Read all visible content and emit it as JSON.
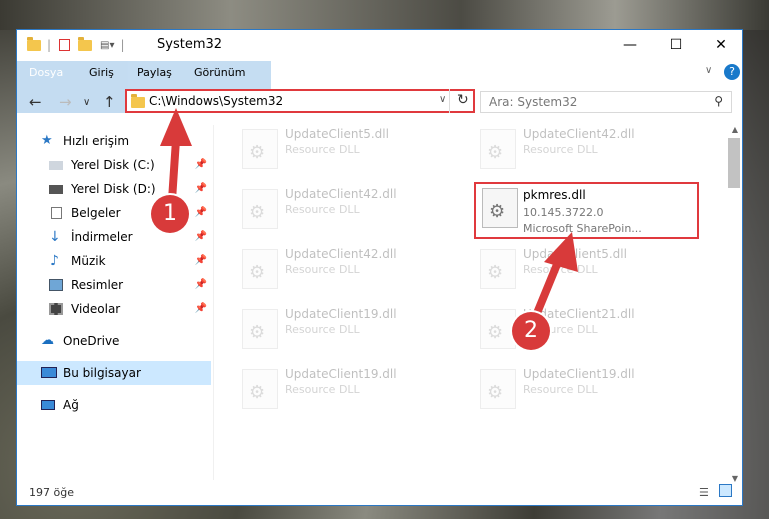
{
  "window": {
    "title": "System32"
  },
  "controls": {
    "minimize": "—",
    "maximize": "☐",
    "close": "✕",
    "help": "?"
  },
  "ribbon": {
    "tabs": [
      "Dosya",
      "Giriş",
      "Paylaş",
      "Görünüm"
    ]
  },
  "address": {
    "path": "C:\\Windows\\System32",
    "refresh": "↻"
  },
  "search": {
    "placeholder": "Ara: System32"
  },
  "sidebar": {
    "items": [
      {
        "label": "Hızlı erişim"
      },
      {
        "label": "Yerel Disk (C:)"
      },
      {
        "label": "Yerel Disk (D:)"
      },
      {
        "label": "Belgeler"
      },
      {
        "label": "İndirmeler"
      },
      {
        "label": "Müzik"
      },
      {
        "label": "Resimler"
      },
      {
        "label": "Videolar"
      },
      {
        "label": "OneDrive"
      },
      {
        "label": "Bu bilgisayar"
      },
      {
        "label": "Ağ"
      }
    ]
  },
  "files": [
    {
      "name": "UpdateClient5.dll",
      "desc": "Resource DLL"
    },
    {
      "name": "UpdateClient42.dll",
      "desc": "Resource DLL"
    },
    {
      "name": "UpdateClient42.dll",
      "desc": "Resource DLL"
    },
    {
      "name": "UpdateClient42.dll",
      "desc": "Resource DLL"
    },
    {
      "name": "UpdateClient5.dll",
      "desc": "Resource DLL"
    },
    {
      "name": "UpdateClient19.dll",
      "desc": "Resource DLL"
    },
    {
      "name": "UpdateClient21.dll",
      "desc": "Resource DLL"
    },
    {
      "name": "UpdateClient19.dll",
      "desc": "Resource DLL"
    },
    {
      "name": "UpdateClient19.dll",
      "desc": "Resource DLL"
    }
  ],
  "highlighted_file": {
    "name": "pkmres.dll",
    "version": "10.145.3722.0",
    "company": "Microsoft SharePoin..."
  },
  "status": {
    "count": "197 öğe"
  },
  "annotations": {
    "step1": "1",
    "step2": "2"
  }
}
